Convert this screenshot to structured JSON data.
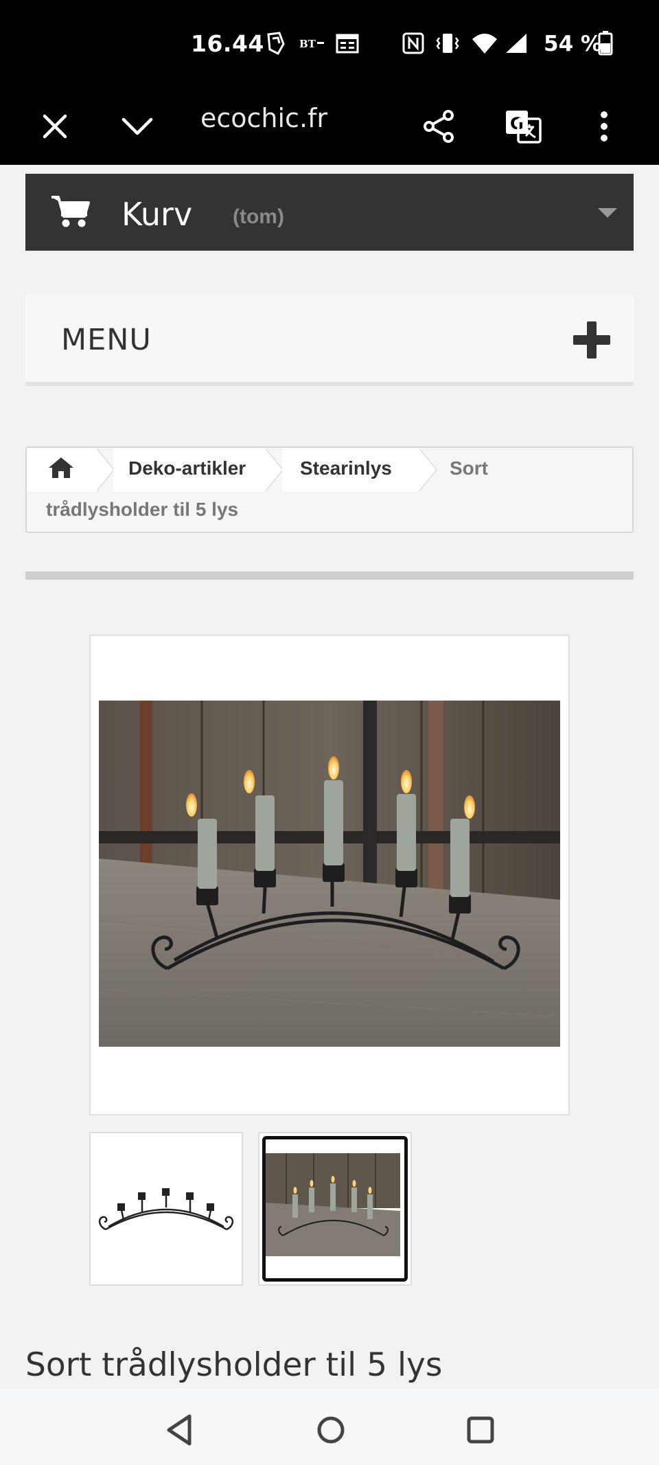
{
  "status_bar": {
    "time": "16.44",
    "battery": "54 %",
    "icons": [
      "notification-app-icon",
      "bt-news-icon",
      "calendar-icon",
      "nfc-icon",
      "vibrate-icon",
      "wifi-icon",
      "signal-icon",
      "battery-icon"
    ]
  },
  "browser": {
    "url": "ecochic.fr",
    "buttons": [
      "close-icon",
      "chevron-down-icon",
      "share-icon",
      "translate-icon",
      "more-vert-icon"
    ]
  },
  "cart": {
    "label": "Kurv",
    "status": "(tom)"
  },
  "menu": {
    "label": "MENU"
  },
  "breadcrumb": {
    "items": [
      "Deko-artikler",
      "Stearinlys"
    ],
    "current_line1": "Sort",
    "current_line2": "trådlysholder til 5 lys"
  },
  "product": {
    "title": "Sort trådlysholder til 5 lys"
  },
  "colors": {
    "toolbar": "#000000",
    "cart_bar": "#333333",
    "background": "#f2f2f2"
  }
}
